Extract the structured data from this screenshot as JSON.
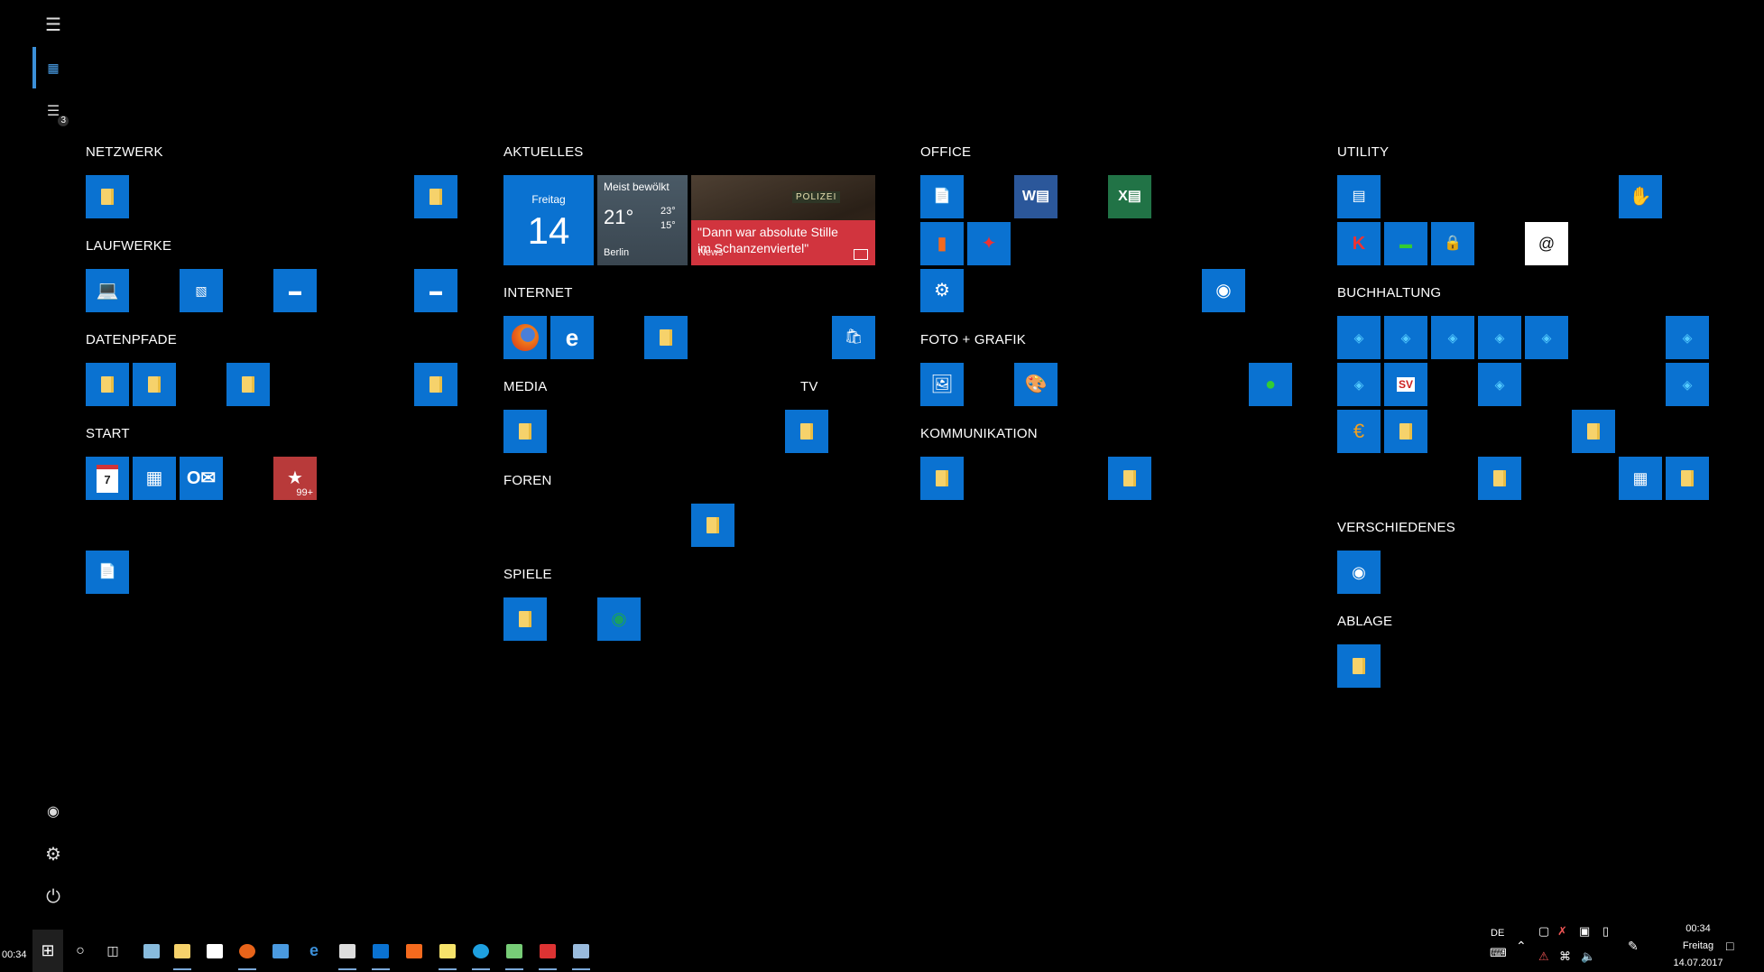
{
  "rail": {
    "clock": "00:34",
    "notification_count": "3"
  },
  "groups": {
    "netzwerk": "NETZWERK",
    "laufwerke": "LAUFWERKE",
    "datenpfade": "DATENPFADE",
    "start": "START",
    "aktuelles": "AKTUELLES",
    "internet": "INTERNET",
    "media": "MEDIA",
    "tv": "TV",
    "foren": "FOREN",
    "spiele": "SPIELE",
    "office": "OFFICE",
    "foto_grafik": "FOTO + GRAFIK",
    "kommunikation": "KOMMUNIKATION",
    "utility": "UTILITY",
    "buchhaltung": "BUCHHALTUNG",
    "verschiedenes": "VERSCHIEDENES",
    "ablage": "ABLAGE"
  },
  "calendar": {
    "day": "Freitag",
    "date": "14"
  },
  "weather": {
    "condition": "Meist bewölkt",
    "temp": "21°",
    "high": "23°",
    "low": "15°",
    "city": "Berlin"
  },
  "news": {
    "headline": "\"Dann war absolute Stille im Schanzenviertel\"",
    "label": "News",
    "photo_text": "POLIZEI"
  },
  "start_tiles": {
    "calendar_app": "7",
    "badge": "99+"
  },
  "taskbar": {
    "language": "DE",
    "time": "00:34",
    "weekday": "Freitag",
    "date": "14.07.2017"
  },
  "colors": {
    "tile": "#0a72d1",
    "accent": "#3b8fd8",
    "news": "#d1343e",
    "background": "#000000"
  }
}
